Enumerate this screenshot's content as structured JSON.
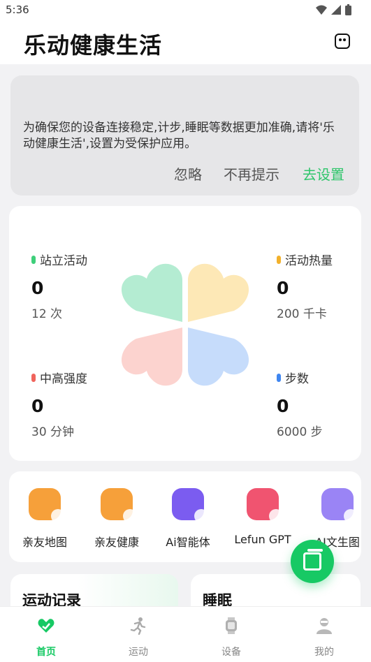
{
  "status_bar": {
    "time": "5:36"
  },
  "header": {
    "title": "乐动健康生活"
  },
  "notice": {
    "message": "为确保您的设备连接稳定,计步,睡眠等数据更加准确,请将'乐动健康生活',设置为受保护应用。",
    "ignore_label": "忽略",
    "no_more_label": "不再提示",
    "goto_settings_label": "去设置"
  },
  "stats": [
    {
      "label": "站立活动",
      "value": "0",
      "goal": "12 次",
      "color": "#3ecf7a"
    },
    {
      "label": "活动热量",
      "value": "0",
      "goal": "200 千卡",
      "color": "#f2b12c"
    },
    {
      "label": "中高强度",
      "value": "0",
      "goal": "30 分钟",
      "color": "#f0645c"
    },
    {
      "label": "步数",
      "value": "0",
      "goal": "6000 步",
      "color": "#3f86f0"
    }
  ],
  "clover_colors": {
    "green": "#b4ecd2",
    "yellow": "#fde8b6",
    "red": "#fcd3cf",
    "blue": "#c6dcfb"
  },
  "tools": [
    {
      "label": "亲友地图",
      "icon": "family-map-icon",
      "color": "#f6a03a"
    },
    {
      "label": "亲友健康",
      "icon": "family-health-icon",
      "color": "#f6a03a"
    },
    {
      "label": "Ai智能体",
      "icon": "ai-agent-icon",
      "color": "#7b5cf0"
    },
    {
      "label": "Lefun GPT",
      "icon": "lefun-gpt-icon",
      "color": "#f05470"
    },
    {
      "label": "AI文生图",
      "icon": "ai-image-icon",
      "color": "#9a84f5"
    }
  ],
  "cards": {
    "run_title": "运动记录",
    "sleep_title": "睡眠"
  },
  "tabbar": [
    {
      "label": "首页",
      "icon": "home-heart-icon",
      "active": true
    },
    {
      "label": "运动",
      "icon": "running-icon",
      "active": false
    },
    {
      "label": "设备",
      "icon": "watch-icon",
      "active": false
    },
    {
      "label": "我的",
      "icon": "profile-icon",
      "active": false
    }
  ]
}
